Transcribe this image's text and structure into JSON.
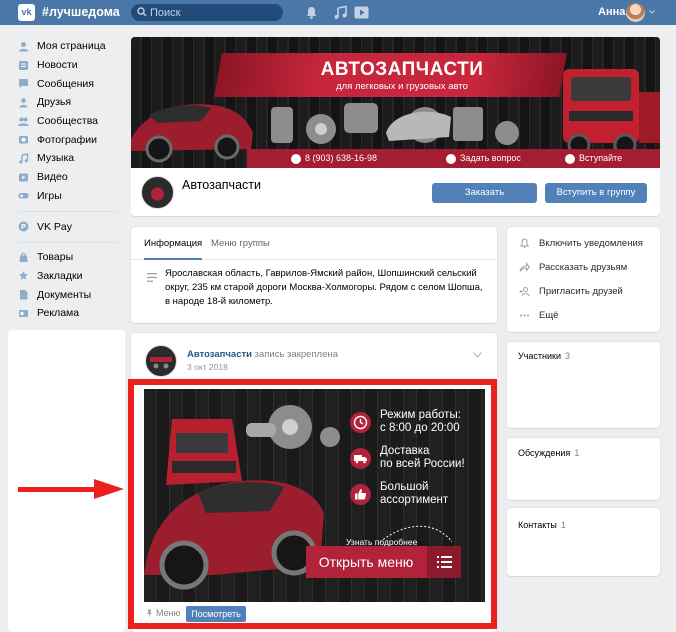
{
  "header": {
    "app_title": "#лучшедома",
    "search_placeholder": "Поиск",
    "user_name": "Анна"
  },
  "sidebar": {
    "items": [
      {
        "label": "Моя страница",
        "icon": "home-icon"
      },
      {
        "label": "Новости",
        "icon": "news-icon"
      },
      {
        "label": "Сообщения",
        "icon": "messages-icon"
      },
      {
        "label": "Друзья",
        "icon": "friends-icon"
      },
      {
        "label": "Сообщества",
        "icon": "communities-icon"
      },
      {
        "label": "Фотографии",
        "icon": "photos-icon"
      },
      {
        "label": "Музыка",
        "icon": "music-icon"
      },
      {
        "label": "Видео",
        "icon": "video-icon"
      },
      {
        "label": "Игры",
        "icon": "games-icon"
      }
    ],
    "pay": {
      "label": "VK Pay",
      "icon": "vkpay-icon"
    },
    "items2": [
      {
        "label": "Товары",
        "icon": "goods-icon"
      },
      {
        "label": "Закладки",
        "icon": "bookmarks-icon"
      },
      {
        "label": "Документы",
        "icon": "documents-icon"
      },
      {
        "label": "Реклама",
        "icon": "ads-icon"
      }
    ]
  },
  "cover": {
    "title": "АВТОЗАПЧАСТИ",
    "subtitle": "для легковых и грузовых авто",
    "phone": "8 (903) 638-16-98",
    "ask": "Задать вопрос",
    "join": "Вступайте"
  },
  "group": {
    "name": "Автозапчасти",
    "order_label": "Заказать",
    "join_label": "Вступить в группу"
  },
  "info": {
    "tabs": [
      "Информация",
      "Меню группы"
    ],
    "address": "Ярославская область, Гаврилов-Ямский район, Шопшинский сельский округ, 235 км старой дороги Москва-Холмогоры. Рядом с селом Шопша, в народе 18-й километр."
  },
  "actions": [
    {
      "label": "Включить уведомления",
      "icon": "bell-icon"
    },
    {
      "label": "Рассказать друзьям",
      "icon": "share-icon"
    },
    {
      "label": "Пригласить друзей",
      "icon": "invite-icon"
    },
    {
      "label": "Ещё",
      "icon": "more-icon"
    }
  ],
  "blocks": {
    "members": {
      "label": "Участники",
      "count": "3"
    },
    "discussions": {
      "label": "Обсуждения",
      "count": "1"
    },
    "contacts": {
      "label": "Контакты",
      "count": "1"
    }
  },
  "post": {
    "author": "Автозапчасти",
    "action": "запись закреплена",
    "date": "3 окт 2018",
    "avatar_text": "АВТОЗАПЧАСТИ"
  },
  "ad": {
    "hours_line1": "Режим работы:",
    "hours_line2": "с 8:00 до 20:00",
    "delivery_line1": "Доставка",
    "delivery_line2": "по всей России!",
    "assortment_line1": "Большой",
    "assortment_line2": "ассортимент",
    "more": "Узнать подробнее",
    "open_menu": "Открыть меню"
  },
  "post_footer": {
    "menu_label": "Меню",
    "view_label": "Посмотреть"
  },
  "colors": {
    "brand": "#4a76a8",
    "accent_red": "#b0233a",
    "highlight": "#ee1f1f"
  }
}
